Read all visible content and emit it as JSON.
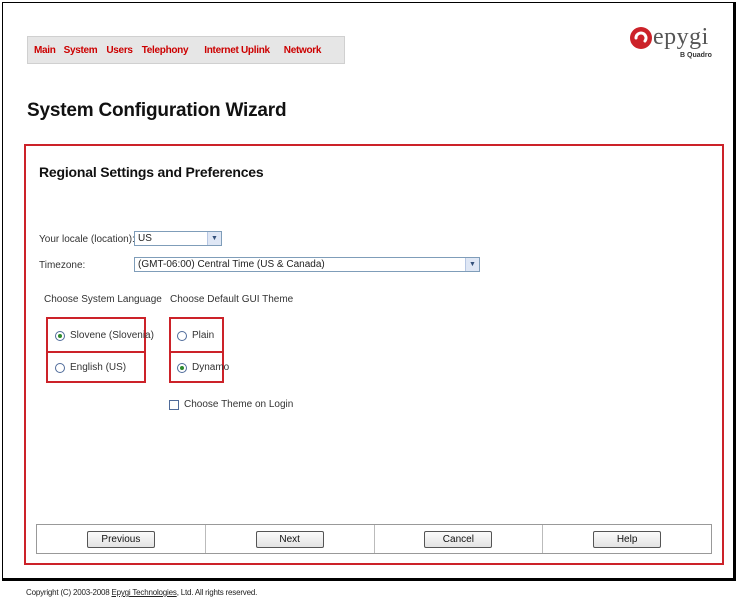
{
  "nav": {
    "items": [
      {
        "label": "Main"
      },
      {
        "label": "System"
      },
      {
        "label": "Users"
      },
      {
        "label": "Telephony"
      },
      {
        "label": "Internet Uplink"
      },
      {
        "label": "Network"
      }
    ]
  },
  "logo": {
    "brand": "epygi",
    "product": "B Quadro"
  },
  "page_title": "System Configuration Wizard",
  "panel": {
    "title": "Regional Settings and Preferences",
    "locale_label": "Your locale (location):",
    "locale_value": "US",
    "timezone_label": "Timezone:",
    "timezone_value": "(GMT-06:00) Central Time (US & Canada)",
    "language": {
      "label": "Choose System Language",
      "options": [
        {
          "label": "Slovene (Slovenia)",
          "selected": true
        },
        {
          "label": "English (US)",
          "selected": false
        }
      ]
    },
    "theme": {
      "label": "Choose Default GUI Theme",
      "options": [
        {
          "label": "Plain",
          "selected": false
        },
        {
          "label": "Dynamo",
          "selected": true
        }
      ],
      "choose_on_login_label": "Choose Theme on Login",
      "choose_on_login_checked": false
    }
  },
  "buttons": {
    "previous": "Previous",
    "next": "Next",
    "cancel": "Cancel",
    "help": "Help"
  },
  "footer": {
    "prefix": "Copyright (C) 2003-2008 ",
    "company": "Epygi Technologies",
    "suffix": ", Ltd. All rights reserved."
  },
  "colors": {
    "accent_red": "#cc2229",
    "nav_text": "#cc0000",
    "radio_selected": "#2d8a2d"
  }
}
